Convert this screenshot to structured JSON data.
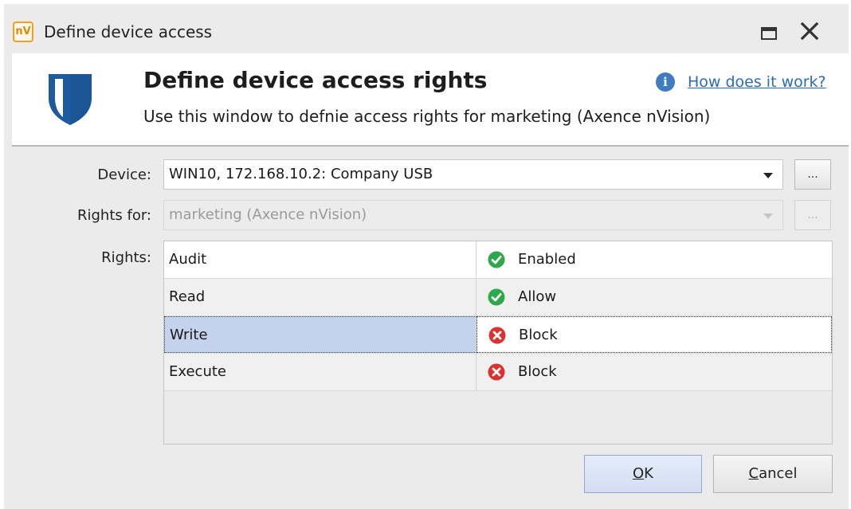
{
  "window": {
    "app_icon_text": "nV",
    "title": "Define device access"
  },
  "header": {
    "title": "Define device access rights",
    "subtitle": "Use this window to defnie access rights for marketing (Axence nVision)",
    "help_link": "How does it work?"
  },
  "form": {
    "device_label": "Device:",
    "device_value": "WIN10, 172.168.10.2: Company USB",
    "rights_for_label": "Rights for:",
    "rights_for_value": "marketing (Axence nVision)",
    "rights_label": "Rights:",
    "browse_label": "..."
  },
  "rights": [
    {
      "name": "Audit",
      "value": "Enabled",
      "state": "ok"
    },
    {
      "name": "Read",
      "value": "Allow",
      "state": "ok"
    },
    {
      "name": "Write",
      "value": "Block",
      "state": "blocked"
    },
    {
      "name": "Execute",
      "value": "Block",
      "state": "blocked"
    }
  ],
  "buttons": {
    "ok_mnemonic": "O",
    "ok_rest": "K",
    "cancel_mnemonic": "C",
    "cancel_rest": "ancel"
  },
  "colors": {
    "ok_green": "#2ea84a",
    "block_red": "#d9322f",
    "shield_blue": "#1e5aa0",
    "link_blue": "#2a6bbd"
  },
  "icons": {
    "app": "nvision-app-icon",
    "maximize": "maximize-icon",
    "close": "close-icon",
    "shield": "shield-icon",
    "info": "info-icon",
    "ok": "check-circle-icon",
    "blocked": "x-circle-icon",
    "dropdown": "chevron-down-icon"
  }
}
